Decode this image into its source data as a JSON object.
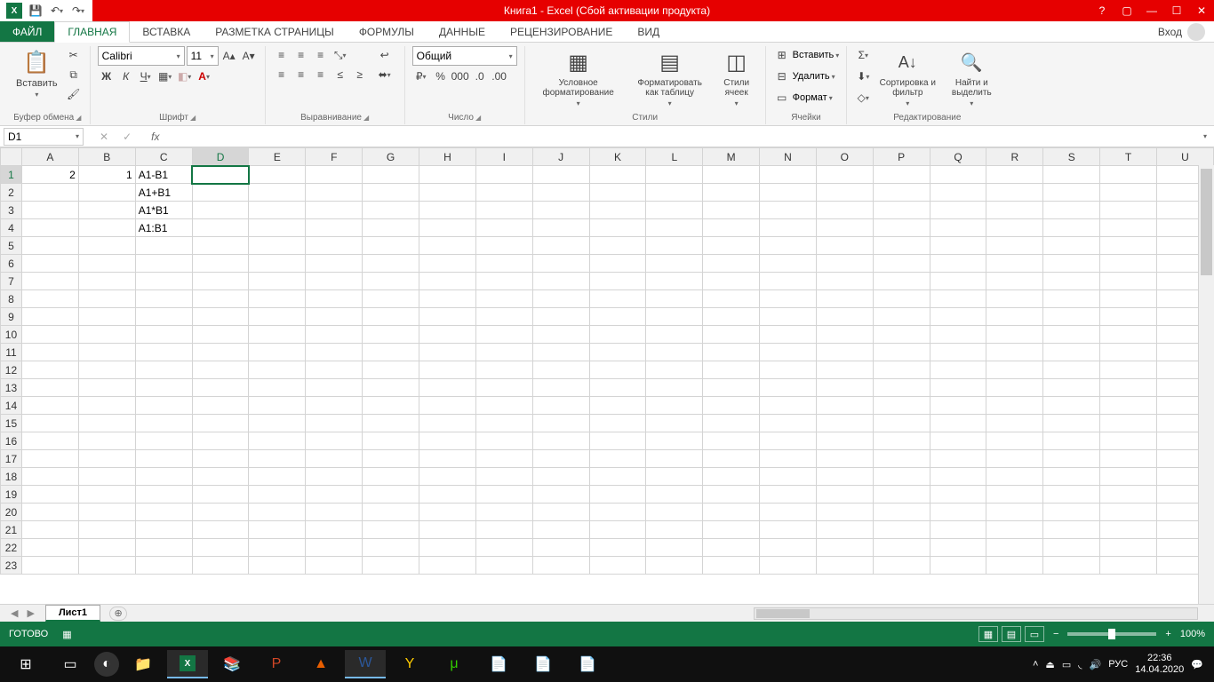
{
  "title": "Книга1 -  Excel (Сбой активации продукта)",
  "tabs": {
    "file": "ФАЙЛ",
    "list": [
      "ГЛАВНАЯ",
      "ВСТАВКА",
      "РАЗМЕТКА СТРАНИЦЫ",
      "ФОРМУЛЫ",
      "ДАННЫЕ",
      "РЕЦЕНЗИРОВАНИЕ",
      "ВИД"
    ],
    "signin": "Вход"
  },
  "ribbon": {
    "clipboard": {
      "paste": "Вставить",
      "label": "Буфер обмена"
    },
    "font": {
      "name": "Calibri",
      "size": "11",
      "label": "Шрифт"
    },
    "align": {
      "label": "Выравнивание"
    },
    "number": {
      "format": "Общий",
      "label": "Число"
    },
    "styles": {
      "cond": "Условное форматирование",
      "table": "Форматировать как таблицу",
      "cell": "Стили ячеек",
      "label": "Стили"
    },
    "cells": {
      "insert": "Вставить",
      "delete": "Удалить",
      "format": "Формат",
      "label": "Ячейки"
    },
    "editing": {
      "sort": "Сортировка и фильтр",
      "find": "Найти и выделить",
      "label": "Редактирование"
    }
  },
  "namebox": "D1",
  "columns": [
    "A",
    "B",
    "C",
    "D",
    "E",
    "F",
    "G",
    "H",
    "I",
    "J",
    "K",
    "L",
    "M",
    "N",
    "O",
    "P",
    "Q",
    "R",
    "S",
    "T",
    "U"
  ],
  "rows": 23,
  "cells": {
    "A1": "2",
    "B1": "1",
    "C1": "A1-B1",
    "C2": "A1+B1",
    "C3": "A1*B1",
    "C4": "A1:B1"
  },
  "active_cell": "D1",
  "sheet": {
    "name": "Лист1"
  },
  "status": {
    "ready": "ГОТОВО",
    "zoom": "100%"
  },
  "tray": {
    "lang": "РУС",
    "time": "22:36",
    "date": "14.04.2020"
  }
}
